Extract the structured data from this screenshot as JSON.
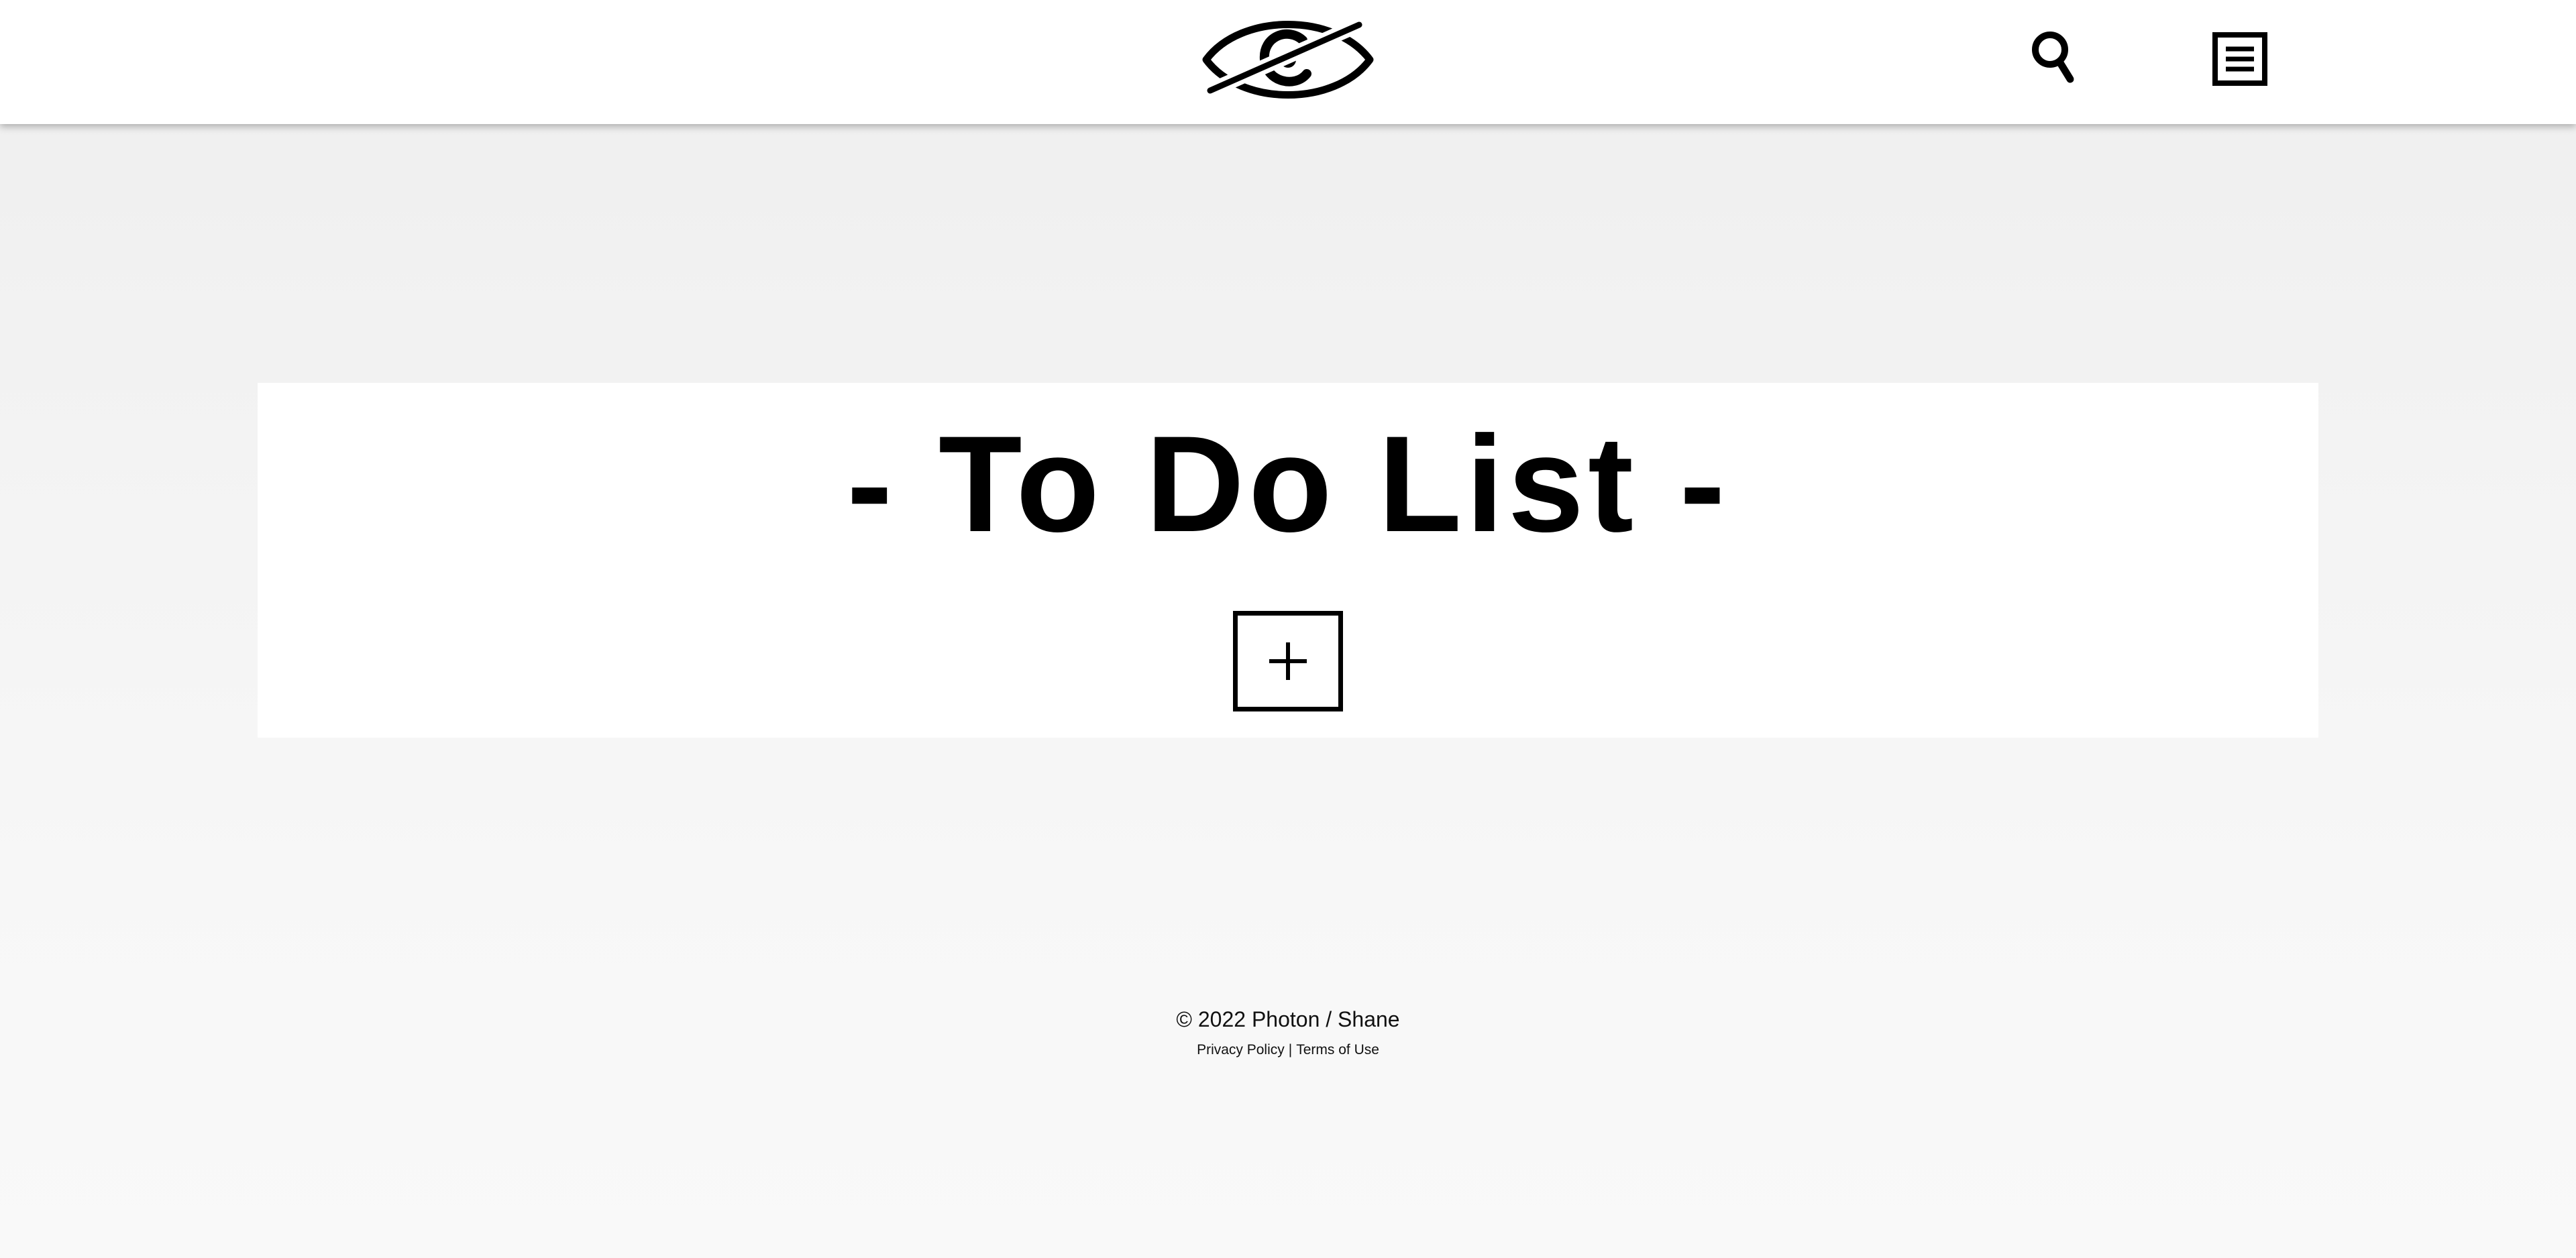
{
  "header": {
    "logo_icon": "eye-slash-logo-icon",
    "search_icon": "search-icon",
    "menu_icon": "menu-icon"
  },
  "main": {
    "title": "- To Do List -",
    "add_button_icon": "plus-icon"
  },
  "footer": {
    "copyright": "© 2022 Photon / Shane",
    "links": [
      {
        "label": "Privacy Policy"
      },
      {
        "label": "Terms of Use"
      }
    ],
    "separator": "|"
  },
  "colors": {
    "page_background": "#f2f2f2",
    "header_background": "#ffffff",
    "card_background": "#ffffff",
    "ink": "#000000"
  }
}
